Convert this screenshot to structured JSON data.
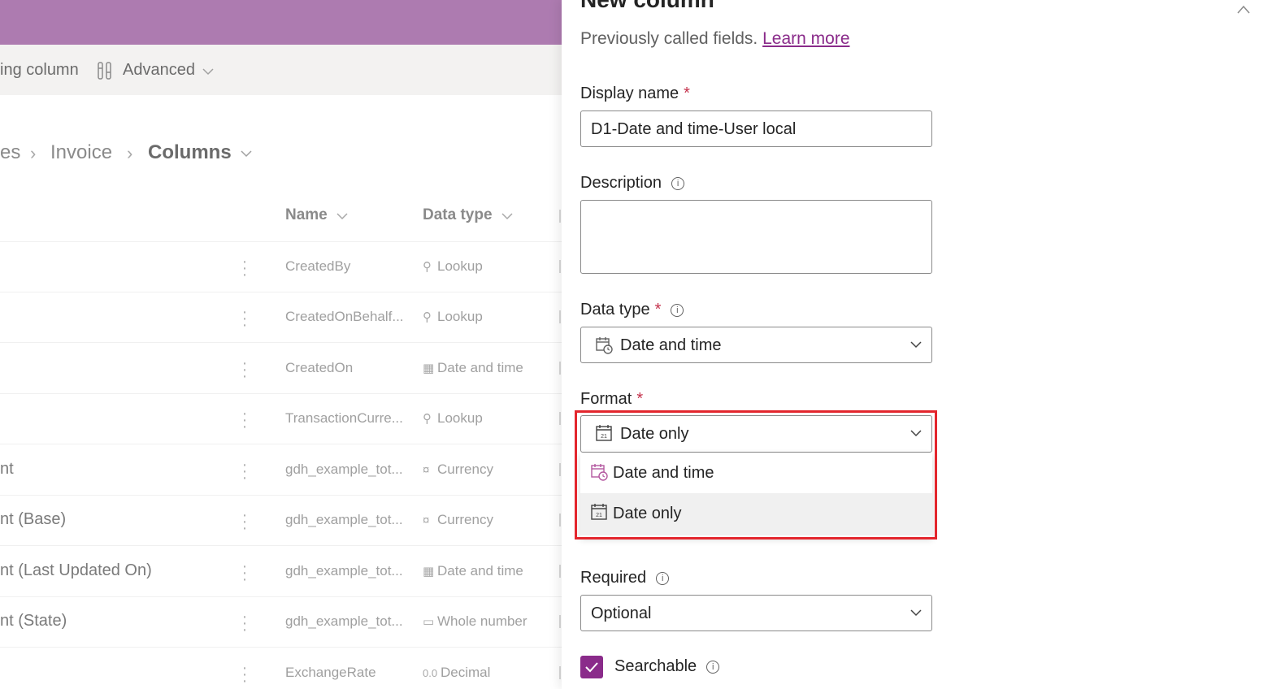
{
  "commandbar": {
    "existing_column_label": "ing column",
    "advanced_label": "Advanced"
  },
  "breadcrumb": {
    "items": [
      "es",
      "Invoice",
      "Columns"
    ]
  },
  "table": {
    "headers": {
      "name": "Name",
      "data_type": "Data type"
    },
    "rows": [
      {
        "left": "",
        "name": "CreatedBy",
        "type": "Lookup",
        "type_icon": "search-icon"
      },
      {
        "left": "",
        "name": "CreatedOnBehalf...",
        "type": "Lookup",
        "type_icon": "search-icon"
      },
      {
        "left": "",
        "name": "CreatedOn",
        "type": "Date and time",
        "type_icon": "calendar-clock-icon"
      },
      {
        "left": "",
        "name": "TransactionCurre...",
        "type": "Lookup",
        "type_icon": "search-icon"
      },
      {
        "left": "nt",
        "name": "gdh_example_tot...",
        "type": "Currency",
        "type_icon": "currency-icon"
      },
      {
        "left": "nt (Base)",
        "name": "gdh_example_tot...",
        "type": "Currency",
        "type_icon": "currency-icon"
      },
      {
        "left": "nt (Last Updated On)",
        "name": "gdh_example_tot...",
        "type": "Date and time",
        "type_icon": "calendar-clock-icon"
      },
      {
        "left": "nt (State)",
        "name": "gdh_example_tot...",
        "type": "Whole number",
        "type_icon": "number-icon"
      },
      {
        "left": "",
        "name": "ExchangeRate",
        "type": "Decimal",
        "type_icon": "decimal-icon",
        "type_prefix": "0.0"
      }
    ]
  },
  "panel": {
    "title": "New column",
    "subtitle": "Previously called fields.",
    "learn_more": "Learn more",
    "display_name": {
      "label": "Display name",
      "required": "*",
      "value": "D1-Date and time-User local"
    },
    "description": {
      "label": "Description",
      "value": ""
    },
    "data_type": {
      "label": "Data type",
      "required": "*",
      "value": "Date and time"
    },
    "format": {
      "label": "Format",
      "required": "*",
      "value": "Date only",
      "options": [
        "Date and time",
        "Date only"
      ],
      "selected_option": "Date only"
    },
    "required_field": {
      "label": "Required",
      "value": "Optional"
    },
    "searchable": {
      "label": "Searchable",
      "checked": true
    }
  },
  "colors": {
    "header_purple": "#ad7bb0",
    "accent": "#8a2b8a",
    "highlight_red": "#e3262d"
  }
}
